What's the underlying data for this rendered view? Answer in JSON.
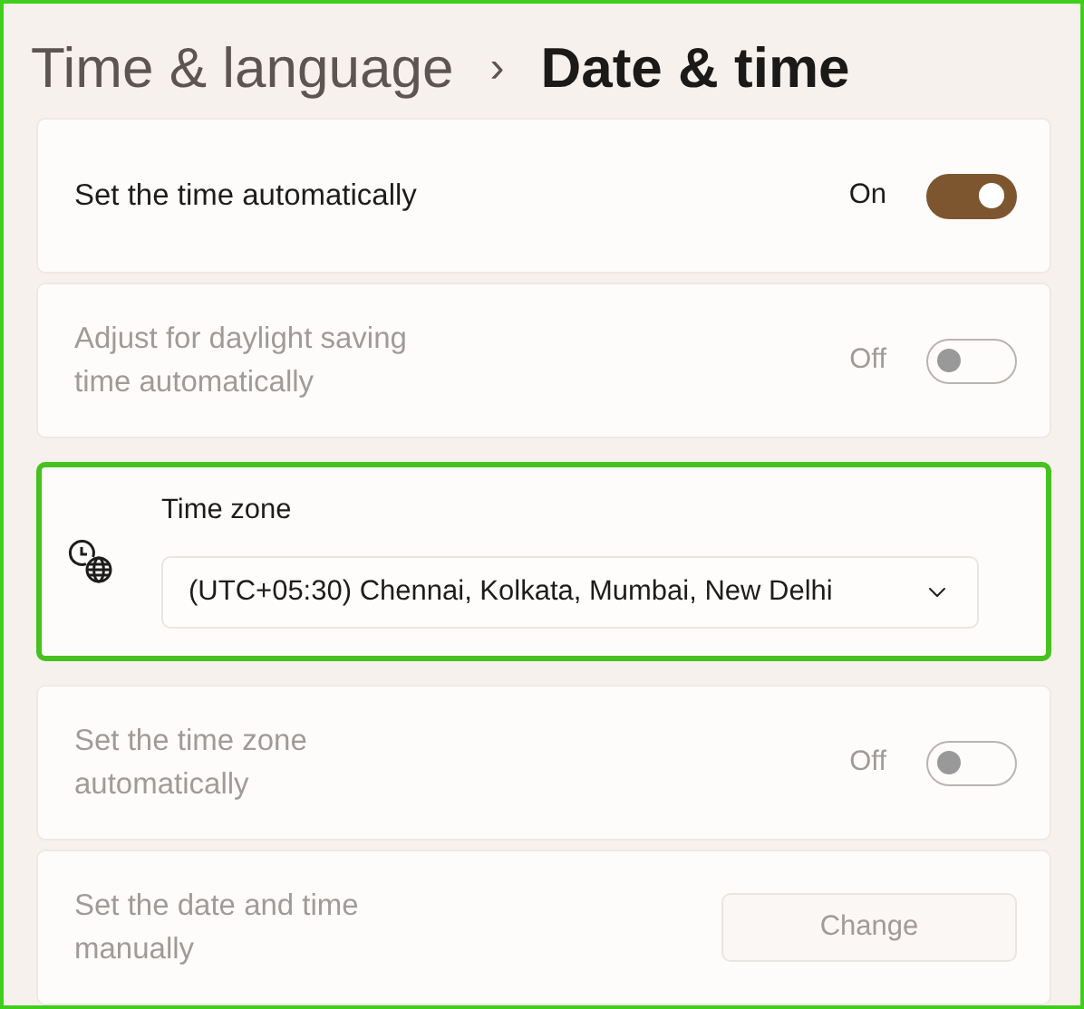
{
  "breadcrumb": {
    "parent": "Time & language",
    "separator": "›",
    "current": "Date & time"
  },
  "settings": [
    {
      "kind": "toggle",
      "label": "Set the time automatically",
      "state_text": "On",
      "on": true,
      "disabled": false
    },
    {
      "kind": "toggle",
      "label": "Adjust for daylight saving time automatically",
      "state_text": "Off",
      "on": false,
      "disabled": true
    },
    {
      "kind": "select",
      "label": "Time zone",
      "value": "(UTC+05:30) Chennai, Kolkata, Mumbai, New Delhi",
      "highlighted": true
    },
    {
      "kind": "toggle",
      "label": "Set the time zone automatically",
      "state_text": "Off",
      "on": false,
      "disabled": true
    },
    {
      "kind": "button",
      "label": "Set the date and time manually",
      "button": "Change",
      "disabled": true
    }
  ]
}
